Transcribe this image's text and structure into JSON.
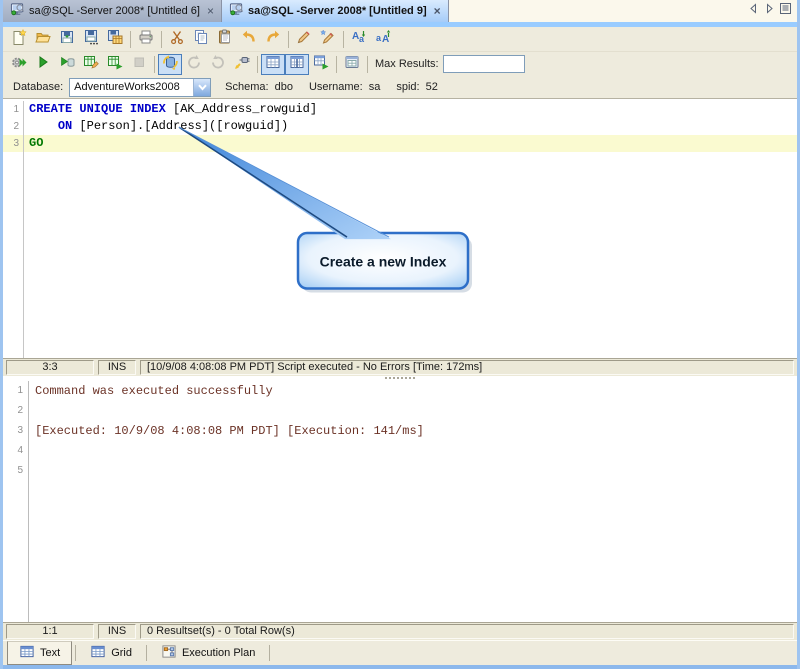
{
  "tab_bar": {
    "tabs": [
      {
        "label": "sa@SQL -Server 2008* [Untitled 6]",
        "active": false
      },
      {
        "label": "sa@SQL -Server 2008* [Untitled 9]",
        "active": true
      }
    ],
    "close_glyph": "×"
  },
  "toolbar_exec": {
    "max_results_label": "Max Results:",
    "max_results_value": ""
  },
  "connection_bar": {
    "database_label": "Database:",
    "database_value": "AdventureWorks2008",
    "schema_label": "Schema:",
    "schema_value": "dbo",
    "username_label": "Username:",
    "username_value": "sa",
    "spid_label": "spid:",
    "spid_value": "52"
  },
  "editor": {
    "lines": [
      {
        "num": "1",
        "keyword": "CREATE UNIQUE INDEX",
        "rest": " [AK_Address_rowguid]"
      },
      {
        "num": "2",
        "indent": "    ",
        "keyword": "ON",
        "rest": " [Person].[Address]([rowguid])"
      },
      {
        "num": "3",
        "keyword": "GO",
        "rest": ""
      }
    ]
  },
  "callout": {
    "text": "Create a new Index"
  },
  "editor_status": {
    "position": "3:3",
    "mode": "INS",
    "message": "[10/9/08 4:08:08 PM PDT] Script executed - No Errors [Time: 172ms]"
  },
  "results": {
    "lines": [
      {
        "num": "1",
        "text": "Command was executed successfully"
      },
      {
        "num": "2",
        "text": ""
      },
      {
        "num": "3",
        "text": "[Executed: 10/9/08 4:08:08 PM PDT] [Execution: 141/ms]"
      },
      {
        "num": "4",
        "text": ""
      },
      {
        "num": "5",
        "text": ""
      }
    ]
  },
  "results_status": {
    "position": "1:1",
    "mode": "INS",
    "message": "0 Resultset(s) - 0 Total Row(s)"
  },
  "bottom_tabs": [
    {
      "label": "Text",
      "active": true
    },
    {
      "label": "Grid",
      "active": false
    },
    {
      "label": "Execution Plan",
      "active": false
    }
  ],
  "colors": {
    "accent_blue_strip": "#99ccff",
    "window_border": "#9ec4f0",
    "toolbar_bg": "#eeebdd",
    "keyword_blue": "#0000c8",
    "go_green": "#007800",
    "current_line_highlight": "#fafad0",
    "results_text": "#6b3226",
    "callout_border": "#2e6fc8",
    "inactive_tab": "#a9b5c9",
    "active_tab": "#b9d6f9"
  },
  "icons": {
    "document-tab-icon": "monitor-with-magnifier-green-dot",
    "new-file-icon": "page-with-star",
    "open-file-icon": "open-folder",
    "save-icon": "floppy-disk",
    "save-as-icon": "floppy-disk-ellipsis",
    "save-all-icon": "floppy-disk-table",
    "print-icon": "printer",
    "cut-icon": "scissors",
    "copy-icon": "two-pages",
    "paste-icon": "clipboard",
    "undo-icon": "curved-arrow-left",
    "redo-icon": "curved-arrow-right",
    "format-sql-icon": "pencil",
    "format-sql-options-icon": "pencil-star",
    "lowercase-icon": "Aa-letters",
    "uppercase-icon": "aA-letters",
    "execute-icon": "gear-double-green-arrow",
    "execute-current-icon": "green-play",
    "execute-script-icon": "green-play-cylinder",
    "execute-edit-icon": "green-table-pencil",
    "execute-explain-icon": "green-table-arrow",
    "stop-icon": "gray-square",
    "auto-commit-icon": "db-cylinder-yellow-arrows",
    "commit-icon": "circular-arrow",
    "rollback-icon": "circular-arrow-reverse",
    "reconnect-icon": "plug-yellow-arrow",
    "results-grid-icon": "window-grid",
    "results-split-icon": "window-grid-split",
    "results-export-icon": "grid-green-arrow",
    "pin-results-icon": "window-grid-small",
    "tab-prev-icon": "triangle-left",
    "tab-next-icon": "triangle-right",
    "tab-list-icon": "list-box",
    "combo-arrow-icon": "chevron-down",
    "text-tab-icon": "blue-table",
    "grid-tab-icon": "blue-table",
    "execution-plan-tab-icon": "plan-diagram"
  }
}
